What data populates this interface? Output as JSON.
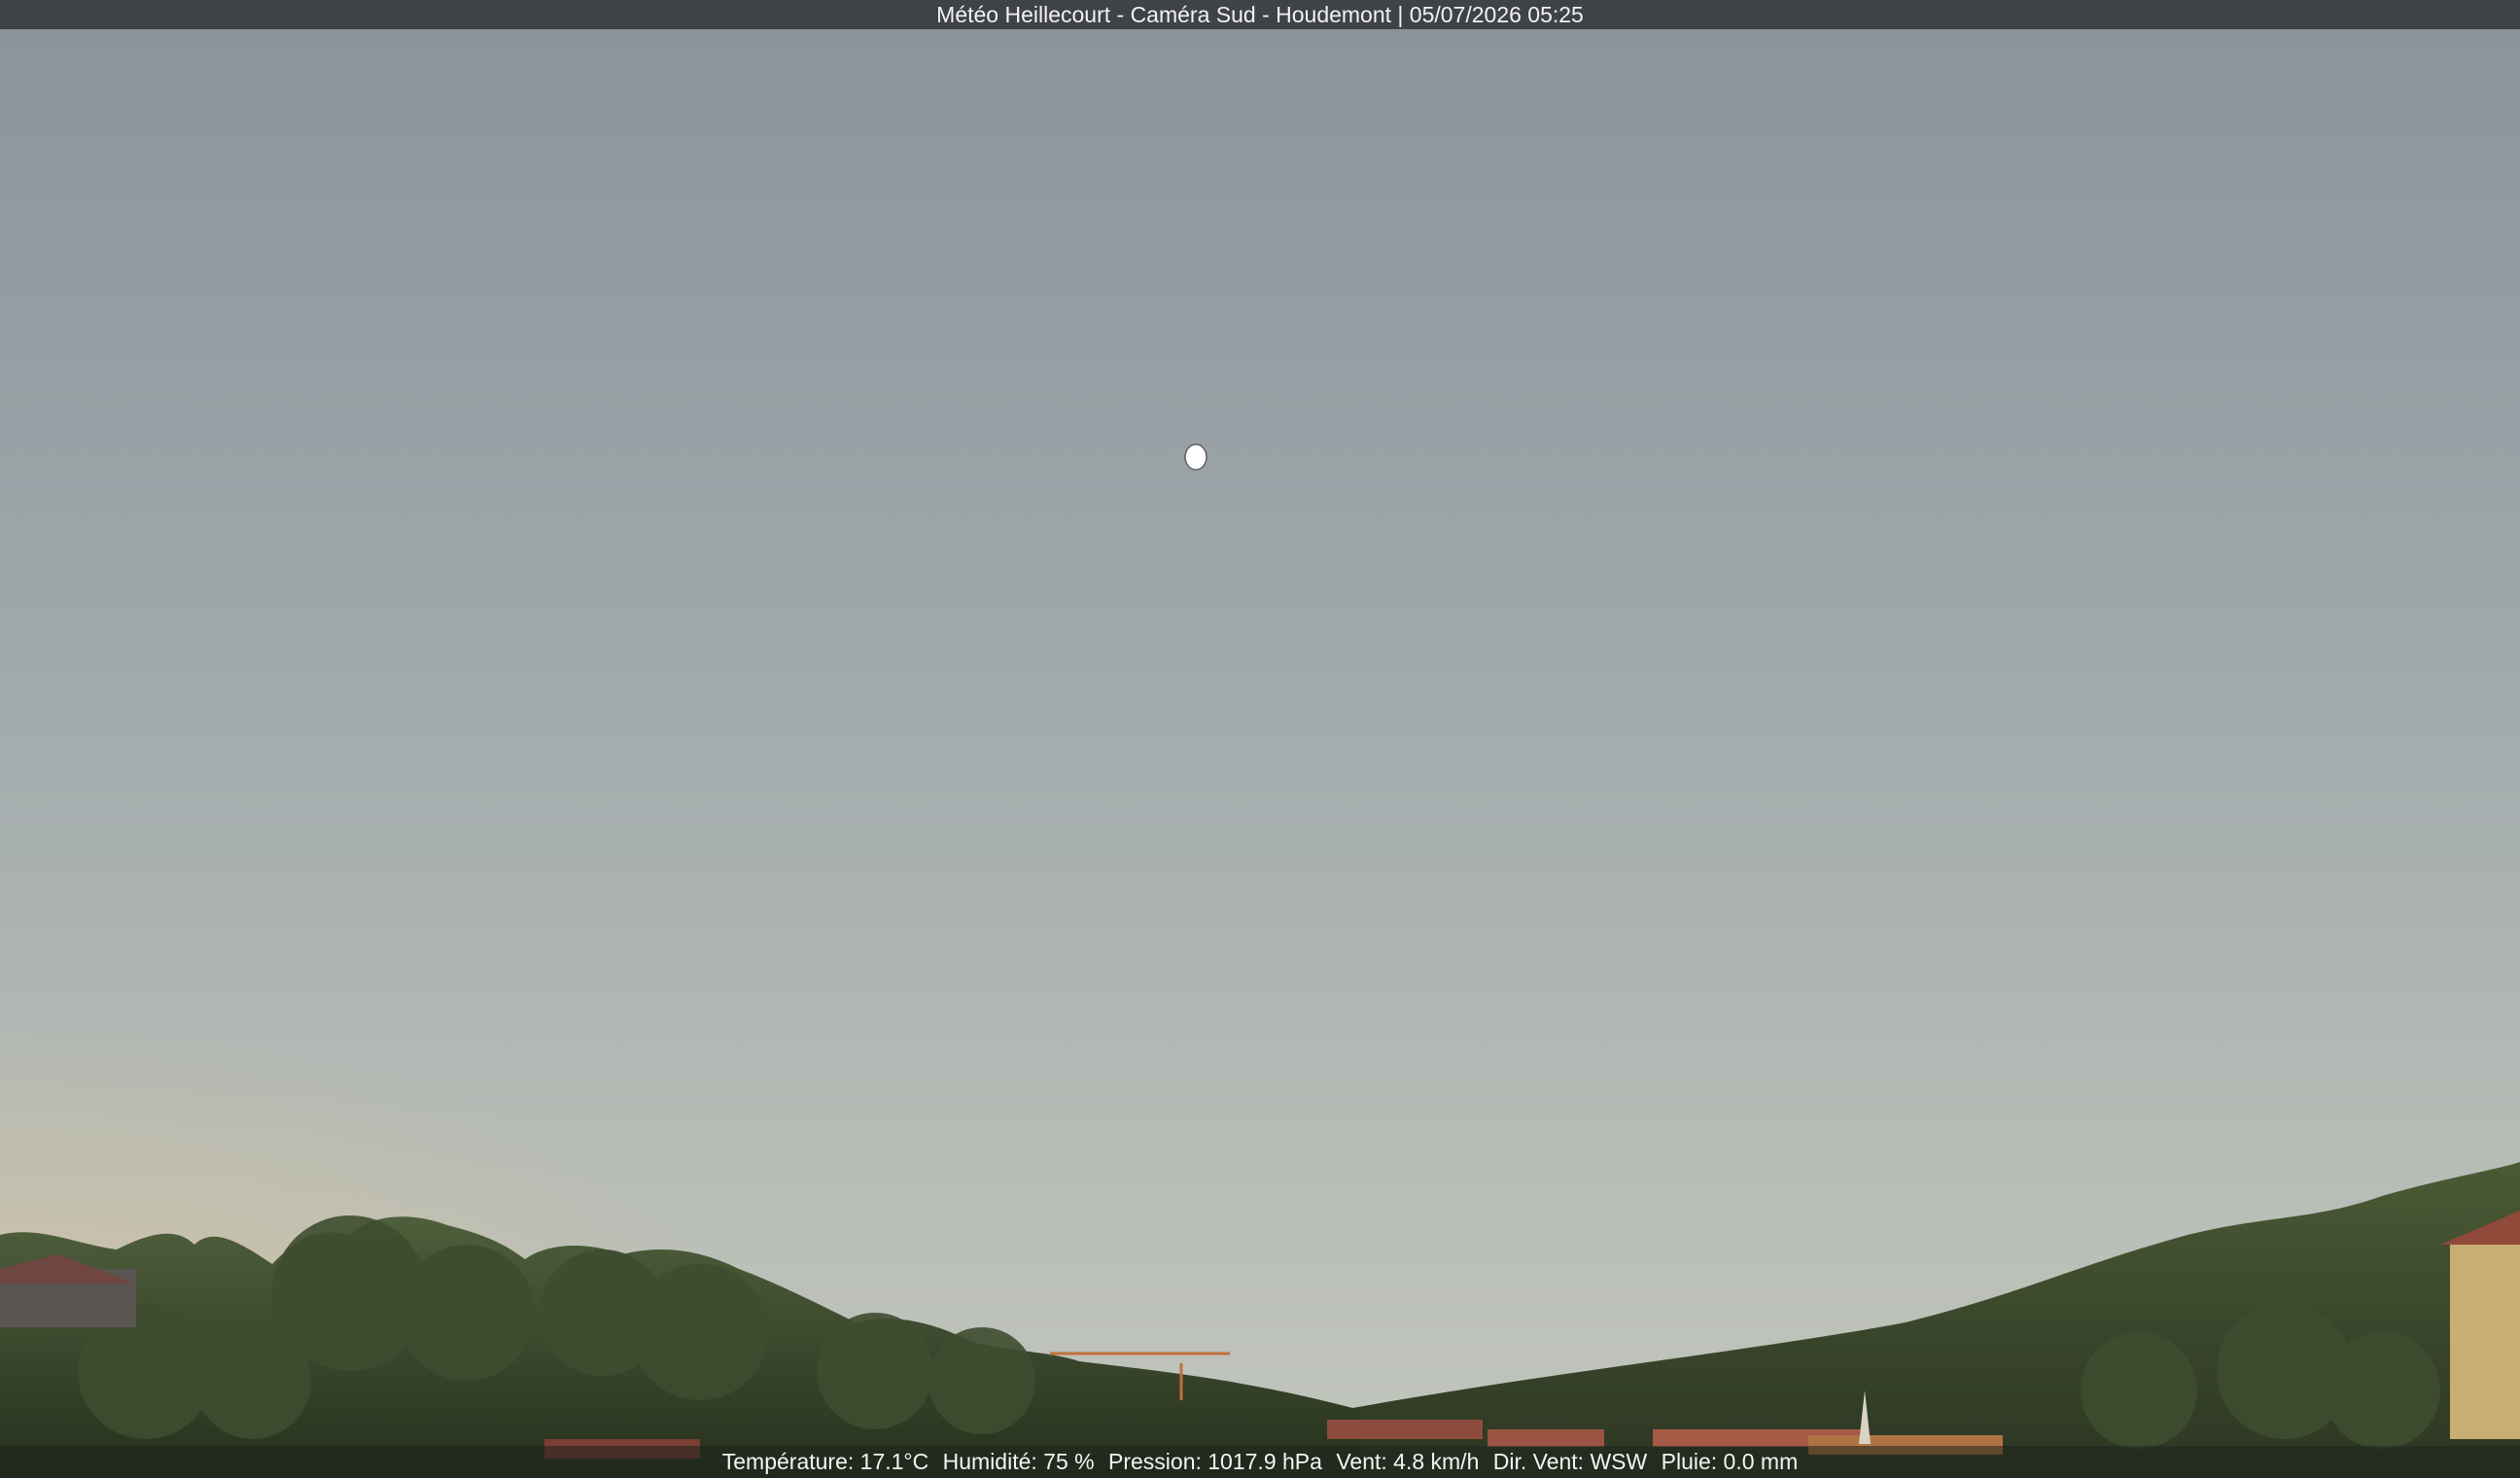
{
  "overlay": {
    "title": "Météo Heillecourt - Caméra Sud - Houdemont | 05/07/2026 05:25"
  },
  "weather": {
    "temperature": "Température: 17.1°C",
    "humidity": "Humidité: 75 %",
    "pressure": "Pression: 1017.9 hPa",
    "wind": "Vent: 4.8 km/h",
    "wind_direction": "Dir. Vent: WSW",
    "rain": "Pluie: 0.0 mm"
  },
  "colors": {
    "sky_top": "#8d949b",
    "sky_mid": "#a9b1b1",
    "sky_horizon": "#c4c6bc",
    "warm_glow": "#d9c7a3",
    "hill": "#3d4a2c",
    "moon": "#ffffff"
  }
}
